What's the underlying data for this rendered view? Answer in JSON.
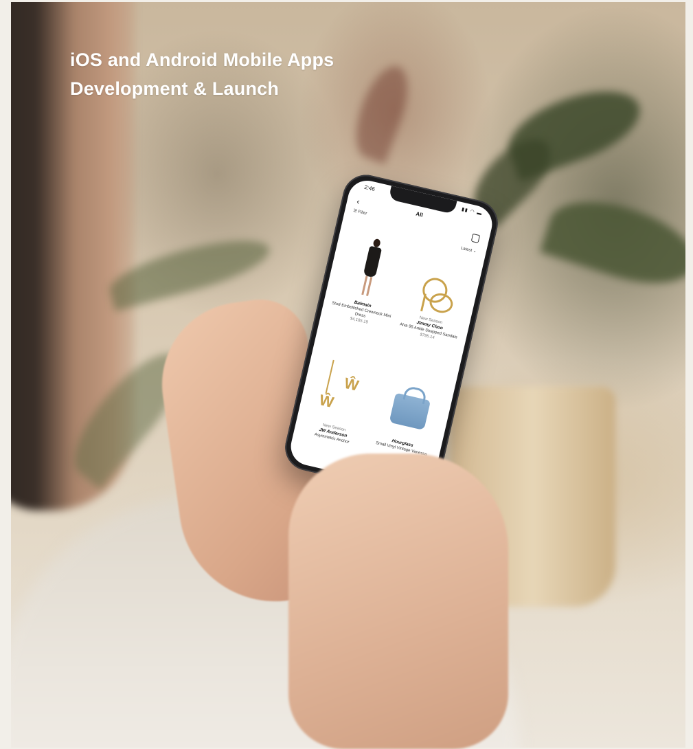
{
  "headline": {
    "line1": "iOS and Android Mobile Apps",
    "line2": "Development & Launch"
  },
  "phone_screen": {
    "status_time": "2:46",
    "nav_title": "All",
    "filter_label": "Filter",
    "sort_label": "Latest",
    "products": [
      {
        "tag": "",
        "brand": "Balmain",
        "name": "Stud-Embellished Crewneck Mini Dress",
        "price": "$4,185.19"
      },
      {
        "tag": "New Season",
        "brand": "Jimmy Choo",
        "name": "Alva 95 Ankle Strapped Sandals",
        "price": "$795.14"
      },
      {
        "tag": "New Season",
        "brand": "JW Anderson",
        "name": "Asymmetric Anchor",
        "price": ""
      },
      {
        "tag": "",
        "brand": "Hourglass",
        "name": "Small Vinyl Vintage Vanessa",
        "price": ""
      }
    ]
  },
  "colors": {
    "headline": "#ffffff",
    "gold": "#c9a24c",
    "bag_blue": "#7aa3c9"
  }
}
